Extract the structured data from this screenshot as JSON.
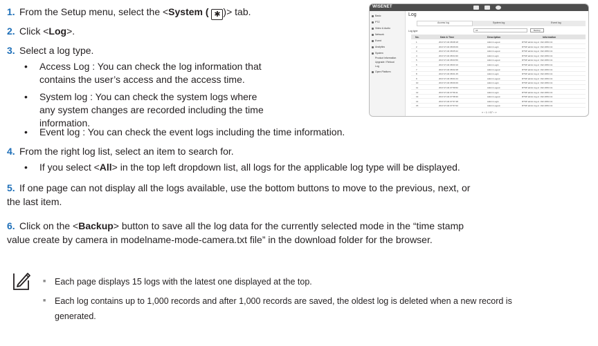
{
  "steps": [
    {
      "num": "1.",
      "pre": "From the Setup menu, select the <",
      "bold": "System (",
      "post": ")> tab.",
      "icon": "gear-icon"
    },
    {
      "num": "2.",
      "pre": "Click <",
      "bold": "Log",
      "post": ">."
    },
    {
      "num": "3.",
      "pre": "Select a log type."
    },
    {
      "num": "4.",
      "pre": "From the right log list, select an item to search for."
    },
    {
      "num": "5.",
      "line1": "If one page can not display all the logs available, use the bottom buttons to move to the previous, next, or",
      "line2": "the last item."
    },
    {
      "num": "6.",
      "line1_pre": "Click on the <",
      "line1_bold": "Backup",
      "line1_post": "> button to save all the log data for the currently selected mode in the “time stamp",
      "line2": "value create by camera in modelname-mode-camera.txt file” in the download folder for the browser."
    }
  ],
  "bullets3": [
    {
      "line1": "Access Log : You can check the log information that",
      "line2": "contains the user’s access and the access time."
    },
    {
      "line1": "System log : You can check the system logs where",
      "line2": "any system changes are recorded including the time",
      "line3": "information."
    },
    {
      "line1": "Event log : You can check the event logs including the time information."
    }
  ],
  "bullet4": {
    "pre": "If you select <",
    "bold": "All",
    "post": "> in the top left dropdown list, all logs for the applicable log type will be displayed."
  },
  "notes": [
    {
      "line1": "Each page displays 15 logs with the latest one displayed at the top."
    },
    {
      "line1": "Each log contains up to 1,000 records and after 1,000 records are saved, the oldest log is deleted when a new record is",
      "line2": "generated."
    }
  ],
  "screenshot": {
    "brand": "WISENET",
    "page_title": "Log",
    "tabs": [
      "Access log",
      "System log",
      "Event log"
    ],
    "log_type_label": "Log type",
    "select_value": "All",
    "backup_label": "Backup",
    "sidebar": [
      "Basic",
      "PTZ",
      "Video & Audio",
      "Network",
      "Event",
      "Analytics",
      "System",
      "Product information",
      "Upgrade / Reboot",
      "Log",
      "Open Platform"
    ],
    "headers": [
      "No.",
      "Date & Time",
      "Description",
      "Information"
    ],
    "rows": [
      {
        "no": "1",
        "date": "2017-07-04 08:08:18",
        "desc": "Admin Logout",
        "info": "RTSP admin log-in: 192.168.0.41"
      },
      {
        "no": "2",
        "date": "2017-07-04 08:06:09",
        "desc": "Admin Login",
        "info": "RTSP admin log-in: 192.168.0.41"
      },
      {
        "no": "3",
        "date": "2017-07-04 08:05:22",
        "desc": "Admin Logout",
        "info": "RTSP admin log-in: 192.168.0.41"
      },
      {
        "no": "4",
        "date": "2017-07-04 08:04:30",
        "desc": "Admin Login",
        "info": "RTSP admin log-in: 192.168.0.41"
      },
      {
        "no": "5",
        "date": "2017-07-04 08:03:56",
        "desc": "Admin Logout",
        "info": "RTSP admin log-in: 192.168.0.41"
      },
      {
        "no": "6",
        "date": "2017-07-04 08:03:10",
        "desc": "Admin Login",
        "info": "RTSP admin log-in: 192.168.0.41"
      },
      {
        "no": "7",
        "date": "2017-07-04 08:02:28",
        "desc": "Admin Logout",
        "info": "RTSP admin log-in: 192.168.0.41"
      },
      {
        "no": "8",
        "date": "2017-07-04 08:01:45",
        "desc": "Admin Login",
        "info": "RTSP admin log-in: 192.168.0.41"
      },
      {
        "no": "9",
        "date": "2017-07-04 08:01:04",
        "desc": "Admin Logout",
        "info": "RTSP admin log-in: 192.168.0.41"
      },
      {
        "no": "10",
        "date": "2017-07-04 08:00:29",
        "desc": "Admin Login",
        "info": "RTSP admin log-in: 192.168.0.41"
      },
      {
        "no": "11",
        "date": "2017-07-04 07:59:52",
        "desc": "Admin Logout",
        "info": "RTSP admin log-in: 192.168.0.41"
      },
      {
        "no": "12",
        "date": "2017-07-04 07:59:11",
        "desc": "Admin Login",
        "info": "RTSP admin log-in: 192.168.0.41"
      },
      {
        "no": "13",
        "date": "2017-07-04 07:58:30",
        "desc": "Admin Logout",
        "info": "RTSP admin log-in: 192.168.0.41"
      },
      {
        "no": "14",
        "date": "2017-07-04 07:57:48",
        "desc": "Admin Login",
        "info": "RTSP admin log-in: 192.168.0.41"
      },
      {
        "no": "15",
        "date": "2017-07-04 07:57:02",
        "desc": "Admin Logout",
        "info": "RTSP admin log-in: 192.168.0.41"
      }
    ],
    "pager": "«  ‹   1 / 67   ›  »"
  },
  "colors": {
    "step_number": "#1e6fb8",
    "body_text": "#231f20",
    "note_marker": "#8a8a8a"
  }
}
